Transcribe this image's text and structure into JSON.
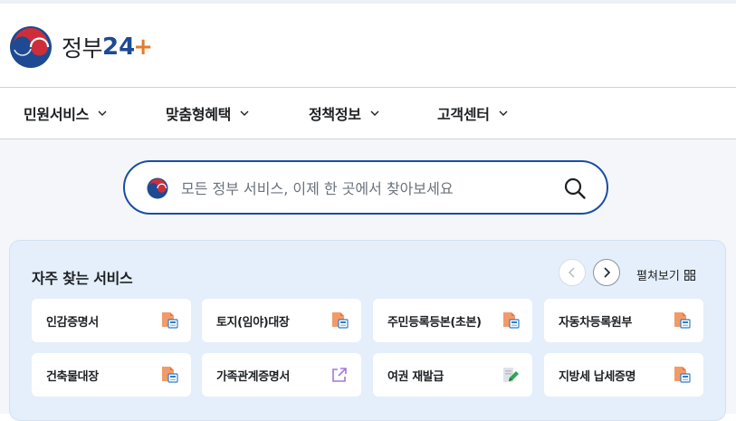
{
  "header": {
    "logo_text": "정부",
    "logo_num": "24",
    "logo_plus": "+"
  },
  "nav": [
    {
      "label": "민원서비스"
    },
    {
      "label": "맞춤형혜택"
    },
    {
      "label": "정책정보"
    },
    {
      "label": "고객센터"
    }
  ],
  "search": {
    "placeholder": "모든 정부 서비스, 이제 한 곳에서 찾아보세요",
    "value": ""
  },
  "frequent": {
    "title": "자주 찾는 서비스",
    "expand_label": "펼쳐보기",
    "items": [
      {
        "label": "인감증명서",
        "icon": "document-print-icon"
      },
      {
        "label": "토지(임야)대장",
        "icon": "document-print-icon"
      },
      {
        "label": "주민등록등본(초본)",
        "icon": "document-print-icon"
      },
      {
        "label": "자동차등록원부",
        "icon": "document-print-icon"
      },
      {
        "label": "건축물대장",
        "icon": "document-print-icon"
      },
      {
        "label": "가족관계증명서",
        "icon": "external-link-icon"
      },
      {
        "label": "여권 재발급",
        "icon": "edit-document-icon"
      },
      {
        "label": "지방세 납세증명",
        "icon": "document-print-icon"
      }
    ]
  },
  "colors": {
    "brand_blue": "#1d4a92",
    "brand_red": "#cd2e3a",
    "accent_orange": "#e37c2c",
    "search_border": "#1b4ea3",
    "panel_bg": "#e4effb"
  }
}
